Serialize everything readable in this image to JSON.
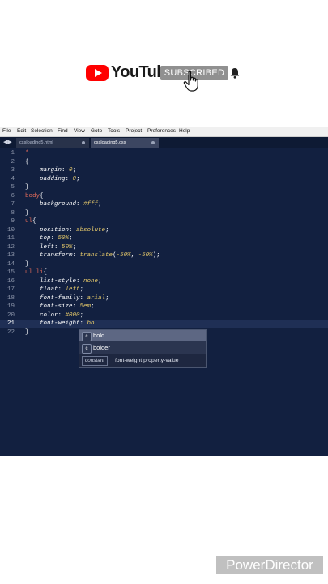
{
  "youtube": {
    "logo_text": "YouTube",
    "subscribe_label": "SUBSCRIBED",
    "icons": [
      "play-logo-icon",
      "bell-icon",
      "hand-cursor-icon"
    ],
    "brand_color": "#ff0000"
  },
  "menu": [
    "File",
    "Edit",
    "Selection",
    "Find",
    "View",
    "Goto",
    "Tools",
    "Project",
    "Preferences",
    "Help"
  ],
  "tabs": [
    {
      "label": "cssloading5.html",
      "active": false
    },
    {
      "label": "cssloading5.css",
      "active": true
    }
  ],
  "code": {
    "current_line": 21,
    "lines": [
      {
        "n": "1",
        "html": "<span class=\"sel\">*</span>"
      },
      {
        "n": "2",
        "html": "{"
      },
      {
        "n": "3",
        "html": "    <span class=\"prop\">margin</span>: <span class=\"val\">0</span>;"
      },
      {
        "n": "4",
        "html": "    <span class=\"prop\">padding</span>: <span class=\"val\">0</span>;"
      },
      {
        "n": "5",
        "html": "}"
      },
      {
        "n": "6",
        "html": "<span class=\"sel\">body</span>{"
      },
      {
        "n": "7",
        "html": "    <span class=\"prop\">background</span>: <span class=\"val\">#fff</span>;"
      },
      {
        "n": "8",
        "html": "}"
      },
      {
        "n": "9",
        "html": "<span class=\"sel\">ul</span>{"
      },
      {
        "n": "10",
        "html": "    <span class=\"prop\">position</span>: <span class=\"val\">absolute</span>;"
      },
      {
        "n": "11",
        "html": "    <span class=\"prop\">top</span>: <span class=\"val\">50%</span>;"
      },
      {
        "n": "12",
        "html": "    <span class=\"prop\">left</span>: <span class=\"val\">50%</span>;"
      },
      {
        "n": "13",
        "html": "    <span class=\"prop\">transform</span>: <span class=\"val\">translate</span>(<span class=\"val\">-50%</span>, <span class=\"val\">-50%</span>);"
      },
      {
        "n": "14",
        "html": "}"
      },
      {
        "n": "15",
        "html": "<span class=\"sel\">ul li</span>{"
      },
      {
        "n": "16",
        "html": "    <span class=\"prop\">list-style</span>: <span class=\"val\">none</span>;"
      },
      {
        "n": "17",
        "html": "    <span class=\"prop\">float</span>: <span class=\"val\">left</span>;"
      },
      {
        "n": "18",
        "html": "    <span class=\"prop\">font-family</span>: <span class=\"val\">arial</span>;"
      },
      {
        "n": "19",
        "html": "    <span class=\"prop\">font-size</span>: <span class=\"val\">5em</span>;"
      },
      {
        "n": "20",
        "html": "    <span class=\"prop\">color</span>: <span class=\"val\">#000</span>;"
      },
      {
        "n": "21",
        "html": "    <span class=\"prop\">font-weight</span>: <span class=\"val\">bo</span>"
      },
      {
        "n": "22",
        "html": "}"
      }
    ]
  },
  "autocomplete": {
    "items": [
      {
        "badge": "c",
        "label": "bold",
        "active": true
      },
      {
        "badge": "c",
        "label": "bolder",
        "active": false
      }
    ],
    "kind": "constant",
    "detail_name": "font-weight",
    "detail_desc": "property-value"
  },
  "watermark": "PowerDirector"
}
